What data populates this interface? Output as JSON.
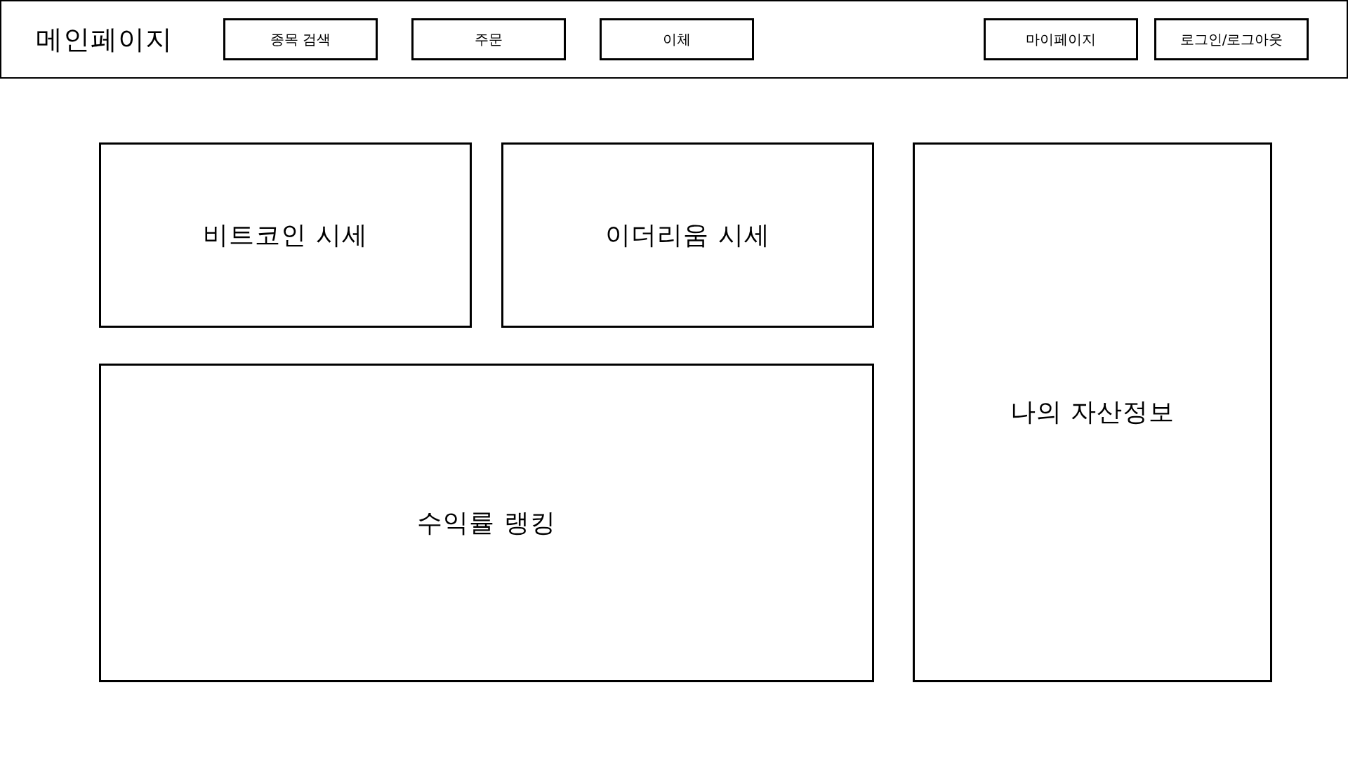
{
  "header": {
    "title": "메인페이지",
    "nav_buttons": [
      "종목 검색",
      "주문",
      "이체"
    ],
    "user_buttons": [
      "마이페이지",
      "로그인/로그아웃"
    ]
  },
  "market_panels": [
    {
      "title": "비트코인 시세"
    },
    {
      "title": "이더리움 시세"
    }
  ],
  "ranking_panel": {
    "title": "수익률 랭킹"
  },
  "asset_panel": {
    "title": "나의 자산정보"
  }
}
